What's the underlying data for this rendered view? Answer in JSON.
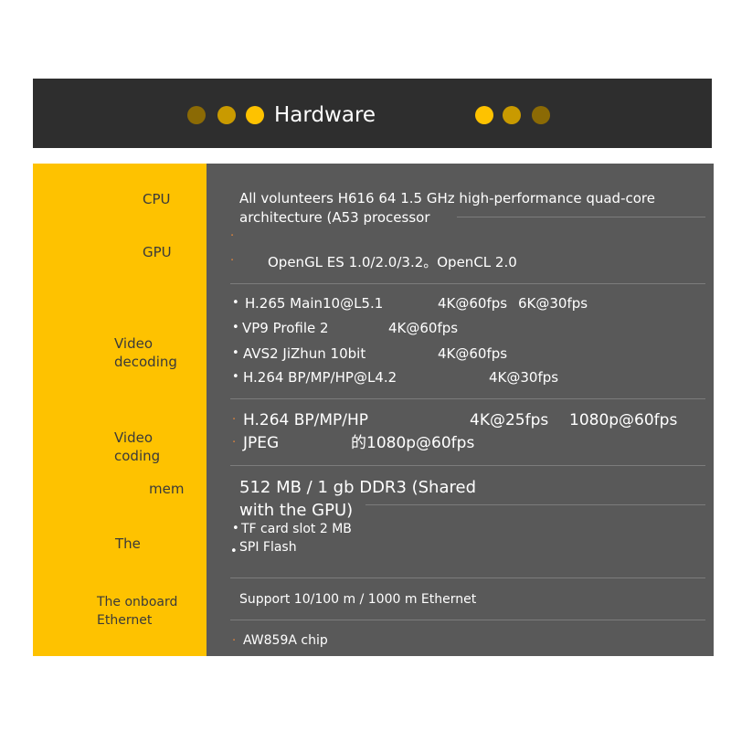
{
  "header": {
    "title": "Hardware",
    "dot_colors": [
      "#8b6a05",
      "#c99a00",
      "#fec200"
    ]
  },
  "colors": {
    "label_column": "#fec200",
    "content_column": "#595959",
    "header_bar": "#2e2e2e",
    "bullet_accent": "#e4863a"
  },
  "rows": {
    "cpu": {
      "label": "CPU",
      "lines": [
        "All volunteers H616 64 1.5 GHz high-performance quad-core",
        "architecture (A53 processor"
      ]
    },
    "gpu": {
      "label": "GPU",
      "line": "OpenGL ES 1.0/2.0/3.2。OpenCL 2.0"
    },
    "video_decoding": {
      "label_lines": [
        "Video",
        "decoding"
      ],
      "items": [
        {
          "codec": "H.265 Main10@L5.1",
          "spec1": "4K@60fps",
          "spec2": "6K@30fps"
        },
        {
          "codec": "VP9 Profile 2",
          "spec1": "4K@60fps"
        },
        {
          "codec": "AVS2 JiZhun 10bit",
          "spec1": "4K@60fps"
        },
        {
          "codec": "H.264 BP/MP/HP@L4.2",
          "spec1": "4K@30fps"
        }
      ]
    },
    "video_coding": {
      "label_lines": [
        "Video",
        "coding"
      ],
      "items": [
        {
          "codec": "H.264 BP/MP/HP",
          "spec1": "4K@25fps",
          "spec2": "1080p@60fps"
        },
        {
          "codec": "JPEG",
          "spec1": "的1080p@60fps"
        }
      ]
    },
    "mem": {
      "label": "mem",
      "lines": [
        "512 MB / 1 gb DDR3 (Shared",
        "with the GPU)"
      ]
    },
    "storage": {
      "label": "The",
      "items": [
        "TF card slot 2 MB",
        "SPI Flash"
      ]
    },
    "ethernet": {
      "label_lines": [
        "The onboard",
        "Ethernet"
      ],
      "line": "Support 10/100 m / 1000 m Ethernet",
      "chip": "AW859A chip"
    }
  }
}
